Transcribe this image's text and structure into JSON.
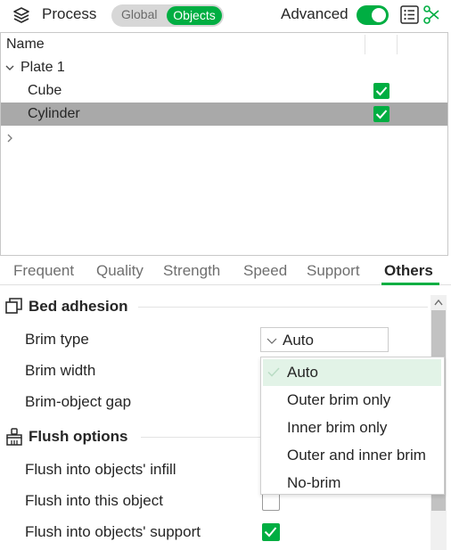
{
  "header": {
    "title": "Process",
    "mode_global": "Global",
    "mode_objects": "Objects",
    "advanced_label": "Advanced",
    "advanced_on": true,
    "icons": [
      "process-stack-icon",
      "list-icon",
      "scissors-icon"
    ],
    "accent_color": "#00ae42"
  },
  "objects": {
    "column_name": "Name",
    "rows": [
      {
        "label": "Plate 1",
        "type": "plate",
        "expanded": true
      },
      {
        "label": "Cube",
        "type": "object",
        "checked": true,
        "selected": false
      },
      {
        "label": "Cylinder",
        "type": "object",
        "checked": true,
        "selected": true
      }
    ]
  },
  "tabs": {
    "items": [
      "Frequent",
      "Quality",
      "Strength",
      "Speed",
      "Support",
      "Others"
    ],
    "active": "Others"
  },
  "settings": {
    "bed_adhesion": {
      "title": "Bed adhesion",
      "brim_type_label": "Brim type",
      "brim_type_value": "Auto",
      "brim_width_label": "Brim width",
      "brim_gap_label": "Brim-object gap"
    },
    "flush": {
      "title": "Flush options",
      "infill_label": "Flush into objects' infill",
      "object_label": "Flush into this object",
      "object_checked": false,
      "support_label": "Flush into objects' support",
      "support_checked": true
    }
  },
  "brim_dropdown": {
    "options": [
      "Auto",
      "Outer brim only",
      "Inner brim only",
      "Outer and inner brim",
      "No-brim"
    ],
    "selected": "Auto"
  }
}
